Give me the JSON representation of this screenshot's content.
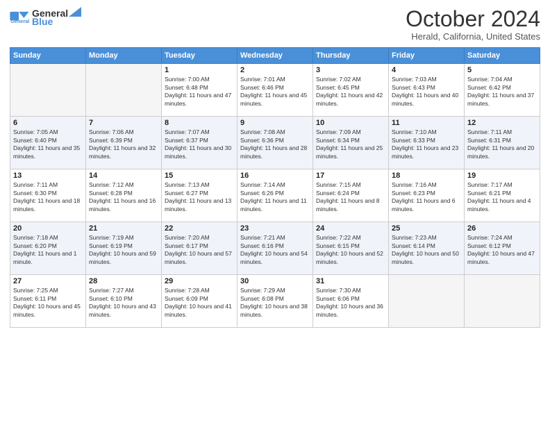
{
  "logo": {
    "text_general": "General",
    "text_blue": "Blue"
  },
  "header": {
    "month": "October 2024",
    "location": "Herald, California, United States"
  },
  "days_of_week": [
    "Sunday",
    "Monday",
    "Tuesday",
    "Wednesday",
    "Thursday",
    "Friday",
    "Saturday"
  ],
  "weeks": [
    [
      {
        "day": "",
        "sunrise": "",
        "sunset": "",
        "daylight": "",
        "empty": true
      },
      {
        "day": "",
        "sunrise": "",
        "sunset": "",
        "daylight": "",
        "empty": true
      },
      {
        "day": "1",
        "sunrise": "Sunrise: 7:00 AM",
        "sunset": "Sunset: 6:48 PM",
        "daylight": "Daylight: 11 hours and 47 minutes."
      },
      {
        "day": "2",
        "sunrise": "Sunrise: 7:01 AM",
        "sunset": "Sunset: 6:46 PM",
        "daylight": "Daylight: 11 hours and 45 minutes."
      },
      {
        "day": "3",
        "sunrise": "Sunrise: 7:02 AM",
        "sunset": "Sunset: 6:45 PM",
        "daylight": "Daylight: 11 hours and 42 minutes."
      },
      {
        "day": "4",
        "sunrise": "Sunrise: 7:03 AM",
        "sunset": "Sunset: 6:43 PM",
        "daylight": "Daylight: 11 hours and 40 minutes."
      },
      {
        "day": "5",
        "sunrise": "Sunrise: 7:04 AM",
        "sunset": "Sunset: 6:42 PM",
        "daylight": "Daylight: 11 hours and 37 minutes."
      }
    ],
    [
      {
        "day": "6",
        "sunrise": "Sunrise: 7:05 AM",
        "sunset": "Sunset: 6:40 PM",
        "daylight": "Daylight: 11 hours and 35 minutes."
      },
      {
        "day": "7",
        "sunrise": "Sunrise: 7:06 AM",
        "sunset": "Sunset: 6:39 PM",
        "daylight": "Daylight: 11 hours and 32 minutes."
      },
      {
        "day": "8",
        "sunrise": "Sunrise: 7:07 AM",
        "sunset": "Sunset: 6:37 PM",
        "daylight": "Daylight: 11 hours and 30 minutes."
      },
      {
        "day": "9",
        "sunrise": "Sunrise: 7:08 AM",
        "sunset": "Sunset: 6:36 PM",
        "daylight": "Daylight: 11 hours and 28 minutes."
      },
      {
        "day": "10",
        "sunrise": "Sunrise: 7:09 AM",
        "sunset": "Sunset: 6:34 PM",
        "daylight": "Daylight: 11 hours and 25 minutes."
      },
      {
        "day": "11",
        "sunrise": "Sunrise: 7:10 AM",
        "sunset": "Sunset: 6:33 PM",
        "daylight": "Daylight: 11 hours and 23 minutes."
      },
      {
        "day": "12",
        "sunrise": "Sunrise: 7:11 AM",
        "sunset": "Sunset: 6:31 PM",
        "daylight": "Daylight: 11 hours and 20 minutes."
      }
    ],
    [
      {
        "day": "13",
        "sunrise": "Sunrise: 7:11 AM",
        "sunset": "Sunset: 6:30 PM",
        "daylight": "Daylight: 11 hours and 18 minutes."
      },
      {
        "day": "14",
        "sunrise": "Sunrise: 7:12 AM",
        "sunset": "Sunset: 6:28 PM",
        "daylight": "Daylight: 11 hours and 16 minutes."
      },
      {
        "day": "15",
        "sunrise": "Sunrise: 7:13 AM",
        "sunset": "Sunset: 6:27 PM",
        "daylight": "Daylight: 11 hours and 13 minutes."
      },
      {
        "day": "16",
        "sunrise": "Sunrise: 7:14 AM",
        "sunset": "Sunset: 6:26 PM",
        "daylight": "Daylight: 11 hours and 11 minutes."
      },
      {
        "day": "17",
        "sunrise": "Sunrise: 7:15 AM",
        "sunset": "Sunset: 6:24 PM",
        "daylight": "Daylight: 11 hours and 8 minutes."
      },
      {
        "day": "18",
        "sunrise": "Sunrise: 7:16 AM",
        "sunset": "Sunset: 6:23 PM",
        "daylight": "Daylight: 11 hours and 6 minutes."
      },
      {
        "day": "19",
        "sunrise": "Sunrise: 7:17 AM",
        "sunset": "Sunset: 6:21 PM",
        "daylight": "Daylight: 11 hours and 4 minutes."
      }
    ],
    [
      {
        "day": "20",
        "sunrise": "Sunrise: 7:18 AM",
        "sunset": "Sunset: 6:20 PM",
        "daylight": "Daylight: 11 hours and 1 minute."
      },
      {
        "day": "21",
        "sunrise": "Sunrise: 7:19 AM",
        "sunset": "Sunset: 6:19 PM",
        "daylight": "Daylight: 10 hours and 59 minutes."
      },
      {
        "day": "22",
        "sunrise": "Sunrise: 7:20 AM",
        "sunset": "Sunset: 6:17 PM",
        "daylight": "Daylight: 10 hours and 57 minutes."
      },
      {
        "day": "23",
        "sunrise": "Sunrise: 7:21 AM",
        "sunset": "Sunset: 6:16 PM",
        "daylight": "Daylight: 10 hours and 54 minutes."
      },
      {
        "day": "24",
        "sunrise": "Sunrise: 7:22 AM",
        "sunset": "Sunset: 6:15 PM",
        "daylight": "Daylight: 10 hours and 52 minutes."
      },
      {
        "day": "25",
        "sunrise": "Sunrise: 7:23 AM",
        "sunset": "Sunset: 6:14 PM",
        "daylight": "Daylight: 10 hours and 50 minutes."
      },
      {
        "day": "26",
        "sunrise": "Sunrise: 7:24 AM",
        "sunset": "Sunset: 6:12 PM",
        "daylight": "Daylight: 10 hours and 47 minutes."
      }
    ],
    [
      {
        "day": "27",
        "sunrise": "Sunrise: 7:25 AM",
        "sunset": "Sunset: 6:11 PM",
        "daylight": "Daylight: 10 hours and 45 minutes."
      },
      {
        "day": "28",
        "sunrise": "Sunrise: 7:27 AM",
        "sunset": "Sunset: 6:10 PM",
        "daylight": "Daylight: 10 hours and 43 minutes."
      },
      {
        "day": "29",
        "sunrise": "Sunrise: 7:28 AM",
        "sunset": "Sunset: 6:09 PM",
        "daylight": "Daylight: 10 hours and 41 minutes."
      },
      {
        "day": "30",
        "sunrise": "Sunrise: 7:29 AM",
        "sunset": "Sunset: 6:08 PM",
        "daylight": "Daylight: 10 hours and 38 minutes."
      },
      {
        "day": "31",
        "sunrise": "Sunrise: 7:30 AM",
        "sunset": "Sunset: 6:06 PM",
        "daylight": "Daylight: 10 hours and 36 minutes."
      },
      {
        "day": "",
        "sunrise": "",
        "sunset": "",
        "daylight": "",
        "empty": true
      },
      {
        "day": "",
        "sunrise": "",
        "sunset": "",
        "daylight": "",
        "empty": true
      }
    ]
  ]
}
